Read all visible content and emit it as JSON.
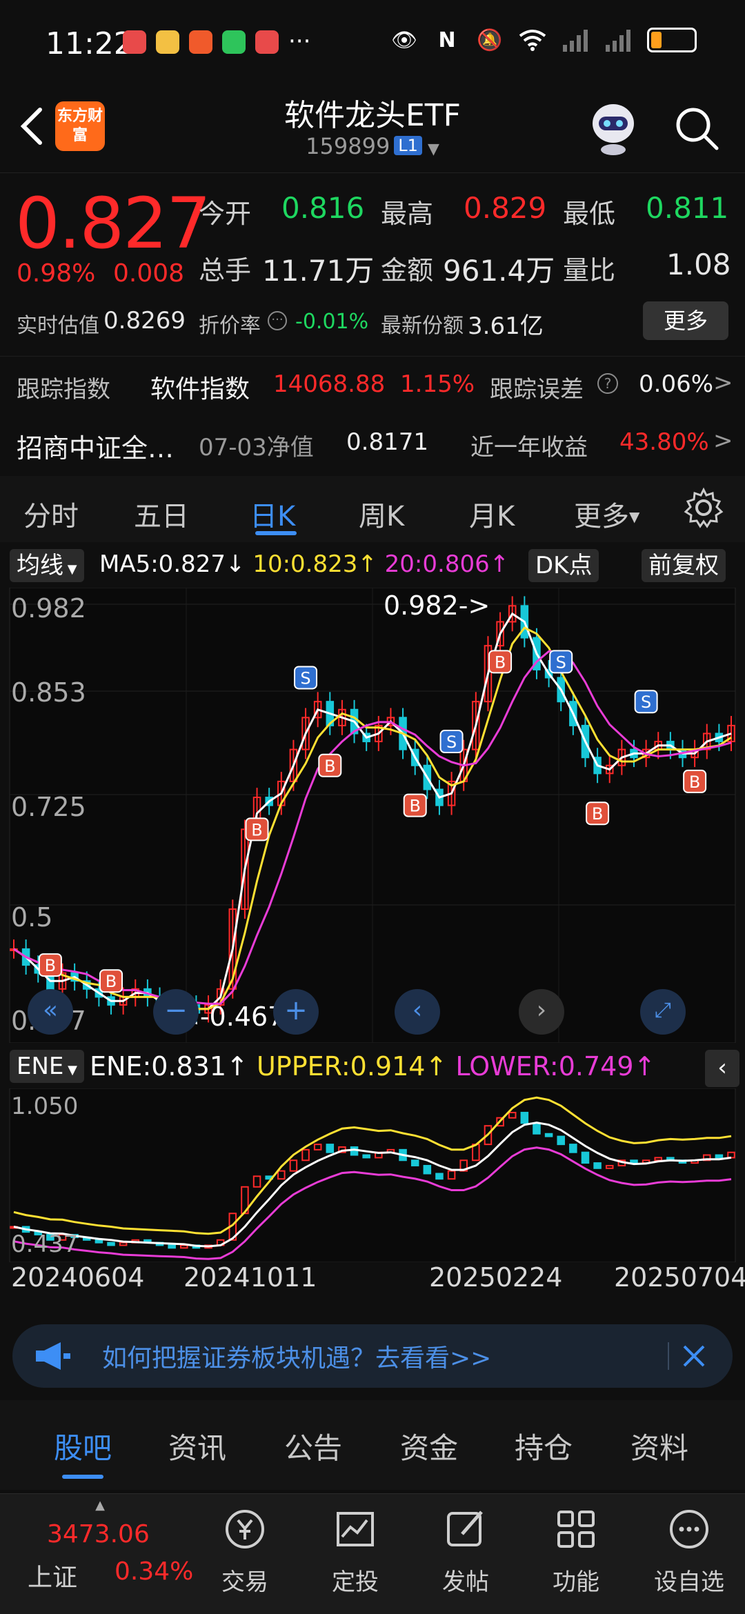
{
  "status": {
    "time": "11:22",
    "icons": [
      "notes-icon",
      "weibo-icon",
      "news-icon",
      "wechat-icon",
      "app-icon",
      "more-dots-icon"
    ],
    "right_icons": [
      "eye-icon",
      "nfc-icon",
      "mute-icon",
      "wifi-icon",
      "signal-icon",
      "signal2-icon",
      "battery-icon"
    ],
    "battery_level": 0.25
  },
  "header": {
    "brand": "东方财富",
    "title": "软件龙头ETF",
    "code": "159899",
    "level": "L1"
  },
  "quote": {
    "price": "0.827",
    "change_pct": "0.98%",
    "change_amt": "0.008",
    "open_label": "今开",
    "open": "0.816",
    "high_label": "最高",
    "high": "0.829",
    "low_label": "最低",
    "low": "0.811",
    "volume_label": "总手",
    "volume": "11.71万",
    "amount_label": "金额",
    "amount": "961.4万",
    "vol_ratio_label": "量比",
    "vol_ratio": "1.08",
    "est_label": "实时估值",
    "est": "0.8269",
    "discount_label": "折价率",
    "discount": "-0.01%",
    "shares_label": "最新份额",
    "shares": "3.61亿",
    "more_label": "更多",
    "track_label": "跟踪指数",
    "track_index": "软件指数",
    "track_value": "14068.88",
    "track_pct": "1.15%",
    "track_err_label": "跟踪误差",
    "track_err": "0.06%",
    "fund_name": "招商中证全…",
    "nav_label": "07-03净值",
    "nav": "0.8171",
    "year_label": "近一年收益",
    "year_return": "43.80%"
  },
  "ktabs": [
    "分时",
    "五日",
    "日K",
    "周K",
    "月K",
    "更多"
  ],
  "ktab_active": 2,
  "ma": {
    "chip": "均线",
    "ma5": "MA5:0.827",
    "ma10": "10:0.823",
    "ma20": "20:0.806",
    "dk": "DK点",
    "adjust": "前复权"
  },
  "chart_data": {
    "type": "candlestick",
    "y_ticks": [
      "0.982",
      "0.853",
      "0.725",
      "0.5",
      "0.467"
    ],
    "high_marker": "0.982->",
    "low_marker": "<-0.467",
    "close_series": [
      0.55,
      0.53,
      0.52,
      0.5,
      0.52,
      0.51,
      0.5,
      0.49,
      0.48,
      0.49,
      0.5,
      0.49,
      0.48,
      0.47,
      0.48,
      0.47,
      0.48,
      0.5,
      0.6,
      0.7,
      0.74,
      0.73,
      0.76,
      0.8,
      0.84,
      0.86,
      0.83,
      0.85,
      0.82,
      0.81,
      0.83,
      0.84,
      0.8,
      0.78,
      0.75,
      0.73,
      0.76,
      0.8,
      0.86,
      0.93,
      0.96,
      0.98,
      0.94,
      0.9,
      0.89,
      0.86,
      0.83,
      0.79,
      0.77,
      0.78,
      0.8,
      0.79,
      0.8,
      0.81,
      0.8,
      0.79,
      0.8,
      0.82,
      0.81,
      0.83
    ]
  },
  "ene": {
    "chip": "ENE",
    "ene": "ENE:0.831",
    "upper": "UPPER:0.914",
    "lower": "LOWER:0.749",
    "y_top": "1.050",
    "y_bottom": "0.437"
  },
  "dates": [
    "20240604",
    "20241011",
    "20250224",
    "20250704"
  ],
  "banner": "如何把握证券板块机遇？去看看>>",
  "subtabs": [
    "股吧",
    "资讯",
    "公告",
    "资金",
    "持仓",
    "资料"
  ],
  "subtab_active": 0,
  "nav": {
    "index_value": "3473.06",
    "index_name": "上证",
    "index_pct": "0.34%",
    "items": [
      "交易",
      "定投",
      "发帖",
      "功能",
      "设自选"
    ]
  },
  "colors": {
    "up": "#ff2a2a",
    "down": "#1ed760",
    "accent": "#3d8ef5",
    "ma10": "#ffe033",
    "ma20": "#e83cd6"
  }
}
